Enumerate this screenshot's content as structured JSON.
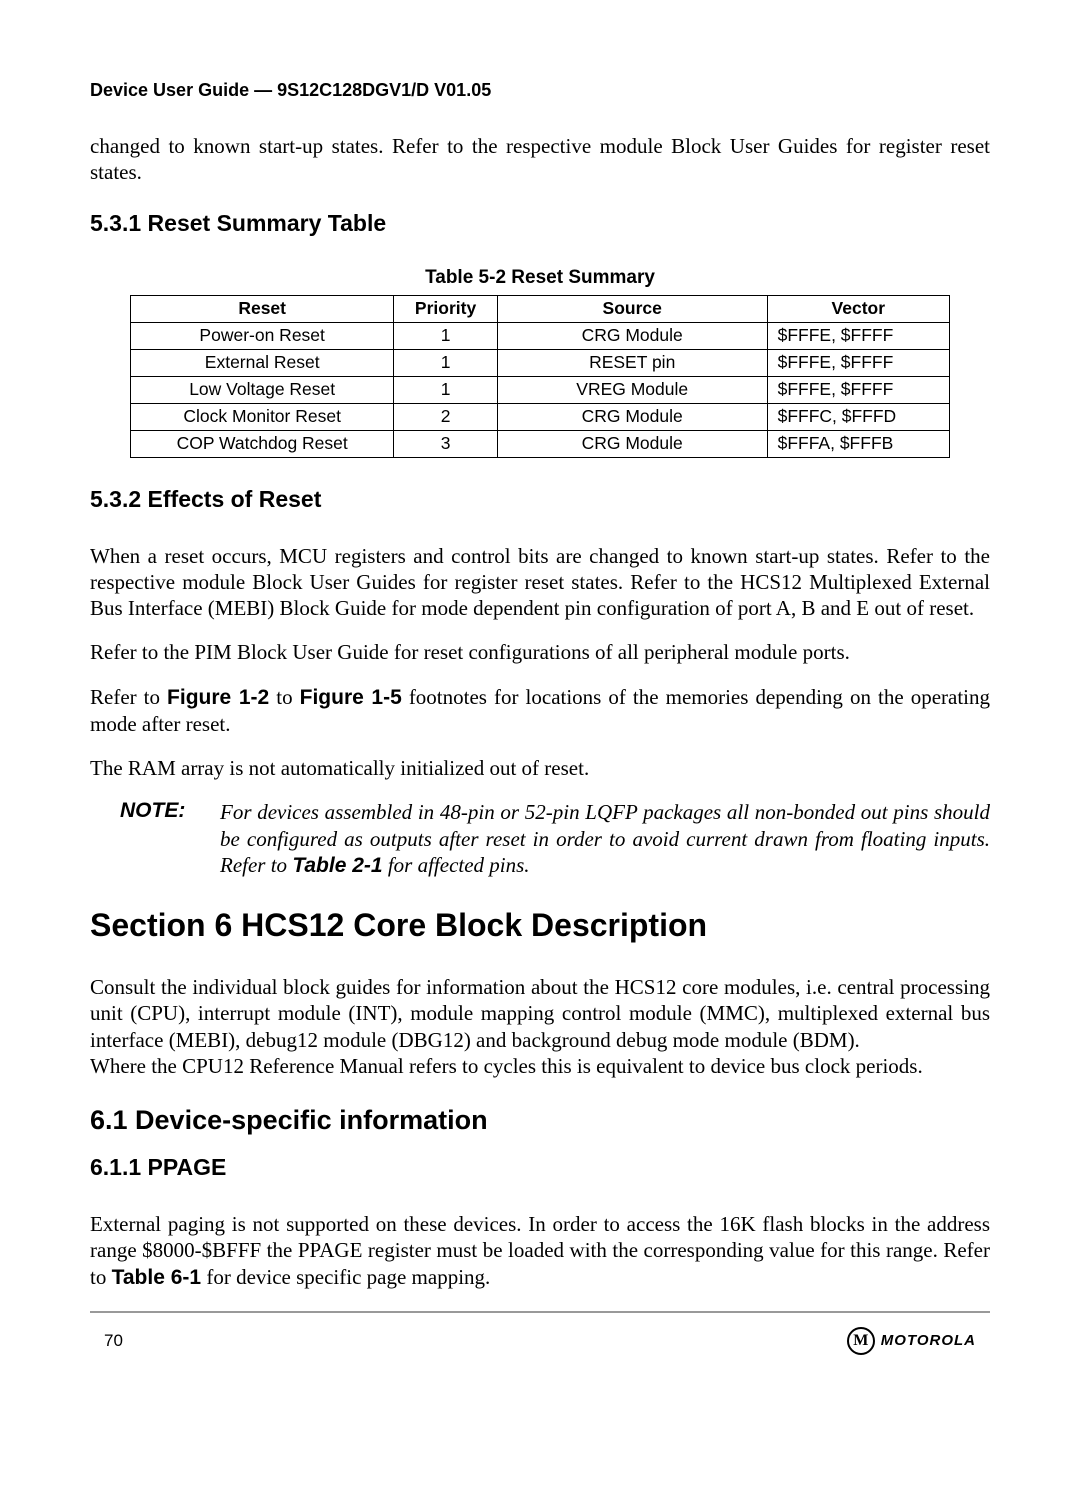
{
  "header": {
    "title": "Device User Guide — 9S12C128DGV1/D V01.05"
  },
  "intro_para": "changed to known start-up states. Refer to the respective module Block User Guides for register reset states.",
  "s531": {
    "heading": "5.3.1  Reset Summary Table",
    "table_caption": "Table 5-2  Reset Summary",
    "columns": [
      "Reset",
      "Priority",
      "Source",
      "Vector"
    ],
    "rows": [
      [
        "Power-on Reset",
        "1",
        "CRG Module",
        "$FFFE, $FFFF"
      ],
      [
        "External Reset",
        "1",
        "RESET pin",
        "$FFFE, $FFFF"
      ],
      [
        "Low Voltage Reset",
        "1",
        "VREG Module",
        "$FFFE, $FFFF"
      ],
      [
        "Clock Monitor Reset",
        "2",
        "CRG Module",
        "$FFFC, $FFFD"
      ],
      [
        "COP Watchdog Reset",
        "3",
        "CRG Module",
        "$FFFA, $FFFB"
      ]
    ]
  },
  "s532": {
    "heading": "5.3.2  Effects of Reset",
    "p1": "When a reset occurs, MCU registers and control bits are changed to known start-up states. Refer to the respective module Block User Guides for register reset states. Refer to the HCS12 Multiplexed External Bus Interface (MEBI) Block Guide for mode dependent pin configuration of port A, B and E out of reset.",
    "p2": "Refer to the PIM Block User Guide for reset configurations of all peripheral module ports.",
    "p3_pre": "Refer to ",
    "p3_ref1": "Figure 1-2",
    "p3_mid": " to ",
    "p3_ref2": "Figure 1-5",
    "p3_post": " footnotes for locations of the memories depending on the operating mode after reset.",
    "p4": "The RAM array is not automatically initialized out of reset.",
    "note_label": "NOTE:",
    "note_pre": "For devices assembled in 48-pin or 52-pin LQFP packages all non-bonded out pins should be configured as outputs after reset in order to avoid current drawn from floating inputs. Refer to ",
    "note_ref": "Table 2-1",
    "note_post": " for affected pins."
  },
  "section6": {
    "heading": "Section 6  HCS12 Core Block Description",
    "p1": "Consult the individual block guides for information about the HCS12 core modules, i.e. central processing unit (CPU), interrupt module (INT), module mapping control module (MMC), multiplexed external bus interface (MEBI), debug12 module (DBG12) and background debug mode module (BDM).",
    "p2": "Where the CPU12 Reference Manual refers to cycles this is equivalent to device bus clock periods."
  },
  "s61": {
    "heading": "6.1  Device-specific information"
  },
  "s611": {
    "heading": "6.1.1  PPAGE",
    "p_pre": "External paging is not supported on these devices. In order to access the 16K flash blocks in the address range $8000-$BFFF the PPAGE register must be loaded with the corresponding value for this range. Refer to ",
    "p_ref": "Table 6-1",
    "p_post": " for device specific page mapping."
  },
  "footer": {
    "page_number": "70",
    "brand": "MOTOROLA",
    "logo_glyph": "M"
  }
}
